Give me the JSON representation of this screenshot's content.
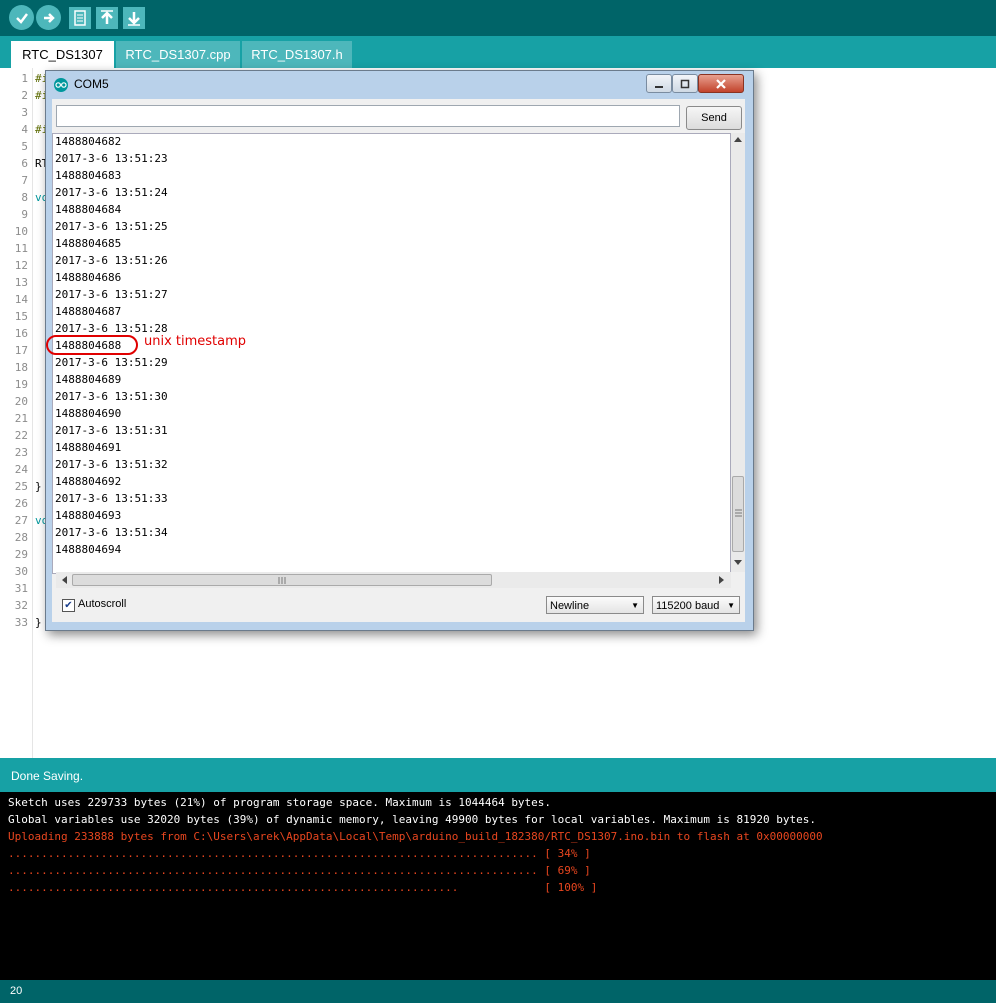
{
  "toolbar": {
    "buttons": [
      {
        "name": "verify",
        "icon": "check-icon"
      },
      {
        "name": "upload",
        "icon": "arrow-right-icon"
      },
      {
        "name": "new",
        "icon": "new-file-icon"
      },
      {
        "name": "open",
        "icon": "arrow-up-icon"
      },
      {
        "name": "save",
        "icon": "arrow-down-icon"
      }
    ]
  },
  "tabs": [
    {
      "label": "RTC_DS1307",
      "active": true
    },
    {
      "label": "RTC_DS1307.cpp",
      "active": false
    },
    {
      "label": "RTC_DS1307.h",
      "active": false
    }
  ],
  "editor": {
    "line_numbers": [
      "1",
      "2",
      "3",
      "4",
      "5",
      "6",
      "7",
      "8",
      "9",
      "10",
      "11",
      "12",
      "13",
      "14",
      "15",
      "16",
      "17",
      "18",
      "19",
      "20",
      "21",
      "22",
      "23",
      "24",
      "25",
      "26",
      "27",
      "28",
      "29",
      "30",
      "31",
      "32",
      "33"
    ],
    "fragments": {
      "l1": "#i",
      "l2": "#i",
      "l4": "#i",
      "l6": "RT",
      "l8": "vo",
      "l25": "}",
      "l27": "vo",
      "l33": "}"
    }
  },
  "serial_monitor": {
    "title": "COM5",
    "input_value": "",
    "send_label": "Send",
    "output_lines": [
      "1488804682",
      "2017-3-6 13:51:23",
      "1488804683",
      "2017-3-6 13:51:24",
      "1488804684",
      "2017-3-6 13:51:25",
      "1488804685",
      "2017-3-6 13:51:26",
      "1488804686",
      "2017-3-6 13:51:27",
      "1488804687",
      "2017-3-6 13:51:28",
      "1488804688",
      "2017-3-6 13:51:29",
      "1488804689",
      "2017-3-6 13:51:30",
      "1488804690",
      "2017-3-6 13:51:31",
      "1488804691",
      "2017-3-6 13:51:32",
      "1488804692",
      "2017-3-6 13:51:33",
      "1488804693",
      "2017-3-6 13:51:34",
      "1488804694"
    ],
    "autoscroll_label": "Autoscroll",
    "autoscroll_checked": true,
    "line_ending": "Newline",
    "baud": "115200 baud"
  },
  "annotation": {
    "label": "unix timestamp",
    "color": "#e00000"
  },
  "status": {
    "text": "Done Saving."
  },
  "console": {
    "lines": [
      {
        "text": "Sketch uses 229733 bytes (21%) of program storage space. Maximum is 1044464 bytes.",
        "color": "#ffffff"
      },
      {
        "text": "Global variables use 32020 bytes (39%) of dynamic memory, leaving 49900 bytes for local variables. Maximum is 81920 bytes.",
        "color": "#ffffff"
      },
      {
        "text": "Uploading 233888 bytes from C:\\Users\\arek\\AppData\\Local\\Temp\\arduino_build_182380/RTC_DS1307.ino.bin to flash at 0x00000000",
        "color": "#e8461f"
      },
      {
        "text": "................................................................................ [ 34% ]",
        "color": "#e8461f"
      },
      {
        "text": "................................................................................ [ 69% ]",
        "color": "#e8461f"
      },
      {
        "text": "....................................................................             [ 100% ]",
        "color": "#e8461f"
      }
    ]
  },
  "footer": {
    "line_number": "20"
  },
  "colors": {
    "toolbar": "#006468",
    "tabs": "#17a1a5",
    "accent": "#4db7bb",
    "console_error": "#e8461f"
  }
}
